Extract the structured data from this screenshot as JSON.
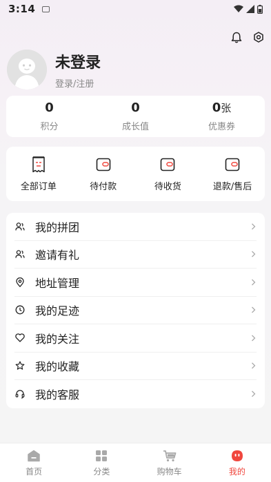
{
  "status_bar": {
    "time": "3:14"
  },
  "profile": {
    "name": "未登录",
    "subtitle": "登录/注册"
  },
  "stats": [
    {
      "value": "0",
      "unit": "",
      "label": "积分"
    },
    {
      "value": "0",
      "unit": "",
      "label": "成长值"
    },
    {
      "value": "0",
      "unit": "张",
      "label": "优惠券"
    }
  ],
  "orders": [
    {
      "label": "全部订单",
      "icon": "receipt-icon"
    },
    {
      "label": "待付款",
      "icon": "wallet-icon"
    },
    {
      "label": "待收货",
      "icon": "wallet-icon"
    },
    {
      "label": "退款/售后",
      "icon": "wallet-icon"
    }
  ],
  "menu": [
    {
      "label": "我的拼团",
      "icon": "users-icon"
    },
    {
      "label": "邀请有礼",
      "icon": "users-icon"
    },
    {
      "label": "地址管理",
      "icon": "location-icon"
    },
    {
      "label": "我的足迹",
      "icon": "clock-icon"
    },
    {
      "label": "我的关注",
      "icon": "heart-icon"
    },
    {
      "label": "我的收藏",
      "icon": "star-icon"
    },
    {
      "label": "我的客服",
      "icon": "headset-icon"
    }
  ],
  "tabs": [
    {
      "label": "首页",
      "icon": "home-icon",
      "active": false
    },
    {
      "label": "分类",
      "icon": "grid-icon",
      "active": false
    },
    {
      "label": "购物车",
      "icon": "cart-icon",
      "active": false
    },
    {
      "label": "我的",
      "icon": "profile-face-icon",
      "active": true
    }
  ],
  "colors": {
    "accent": "#f0473e",
    "text": "#222222",
    "muted": "#888888"
  }
}
